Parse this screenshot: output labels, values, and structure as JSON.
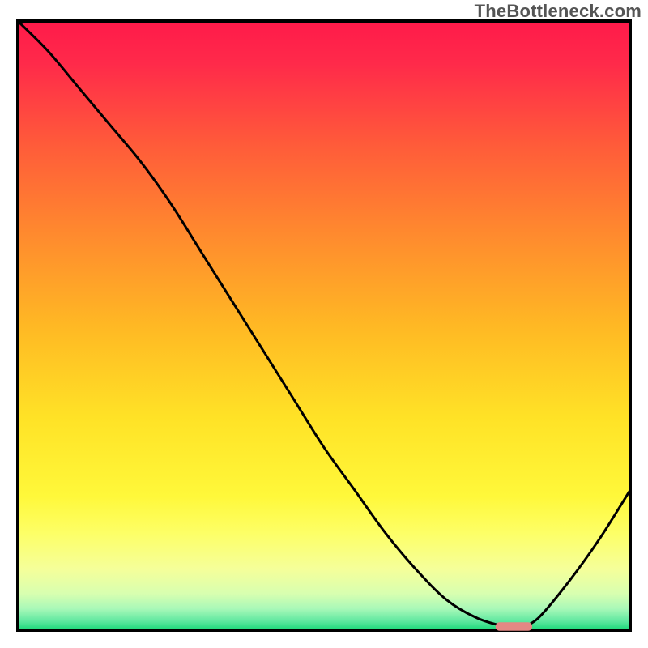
{
  "watermark": "TheBottleneck.com",
  "chart_data": {
    "type": "line",
    "title": "",
    "xlabel": "",
    "ylabel": "",
    "xlim": [
      0,
      100
    ],
    "ylim": [
      0,
      100
    ],
    "series": [
      {
        "name": "bottleneck-curve",
        "x": [
          0,
          5,
          10,
          15,
          20,
          25,
          30,
          35,
          40,
          45,
          50,
          55,
          60,
          65,
          70,
          75,
          80,
          82,
          85,
          90,
          95,
          100
        ],
        "y": [
          100,
          95,
          89,
          83,
          77,
          70,
          62,
          54,
          46,
          38,
          30,
          23,
          16,
          10,
          5,
          2,
          0.5,
          0.5,
          2,
          8,
          15,
          23
        ]
      }
    ],
    "marker": {
      "name": "optimal-marker",
      "x": 81,
      "y": 0.6,
      "width": 6,
      "height": 1.4,
      "color": "#e48884"
    },
    "background_gradient": {
      "stops": [
        {
          "offset": 0.0,
          "color": "#ff1a4a"
        },
        {
          "offset": 0.07,
          "color": "#ff2a4a"
        },
        {
          "offset": 0.2,
          "color": "#ff5a3a"
        },
        {
          "offset": 0.35,
          "color": "#ff8a2e"
        },
        {
          "offset": 0.5,
          "color": "#ffb824"
        },
        {
          "offset": 0.65,
          "color": "#ffe226"
        },
        {
          "offset": 0.78,
          "color": "#fff83a"
        },
        {
          "offset": 0.84,
          "color": "#fdff66"
        },
        {
          "offset": 0.9,
          "color": "#f5ff9a"
        },
        {
          "offset": 0.94,
          "color": "#d8ffb0"
        },
        {
          "offset": 0.965,
          "color": "#a8f8b8"
        },
        {
          "offset": 0.985,
          "color": "#5fe8a0"
        },
        {
          "offset": 1.0,
          "color": "#18d878"
        }
      ]
    },
    "border": {
      "color": "#000000",
      "width": 4
    }
  }
}
